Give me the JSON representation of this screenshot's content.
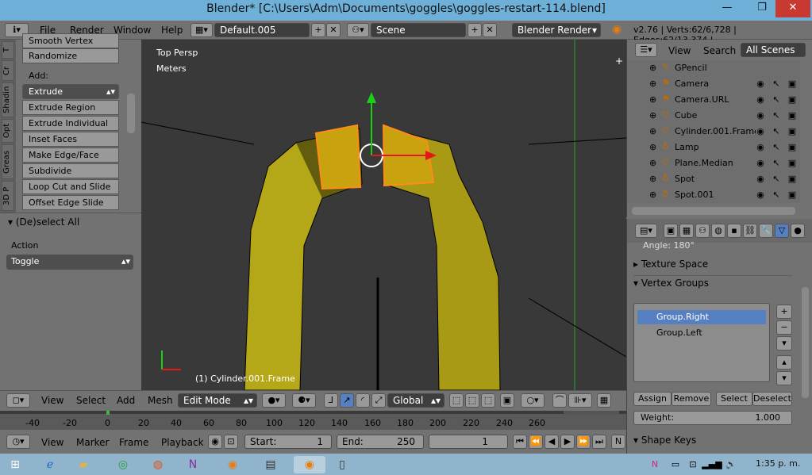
{
  "window": {
    "title": "Blender* [C:\\Users\\Adm\\Documents\\goggles\\goggles-restart-114.blend]",
    "minimize": "—",
    "maximize": "❐",
    "close": "✕"
  },
  "header": {
    "menus": [
      "File",
      "Render",
      "Window",
      "Help"
    ],
    "screen_layout": "Default.005",
    "scene": "Scene",
    "render_engine": "Blender Render",
    "stats": "v2.76 | Verts:62/6,728 | Edges:62/13,374 |"
  },
  "tools": {
    "tabs": [
      "T",
      "Cr",
      "Shadin",
      "Opt",
      "Greas",
      "3D P"
    ],
    "top_cut": "Smooth Vertex",
    "randomize": "Randomize",
    "add_label": "Add:",
    "extrude": "Extrude",
    "buttons": [
      "Extrude Region",
      "Extrude Individual",
      "Inset Faces",
      "Make Edge/Face",
      "Subdivide",
      "Loop Cut and Slide",
      "Offset Edge Slide"
    ],
    "operator_panel": "(De)select All",
    "action_label": "Action",
    "action_value": "Toggle"
  },
  "viewport": {
    "view_name": "Top Persp",
    "units": "Meters",
    "object_info": "(1) Cylinder.001.Frame"
  },
  "view3d_header": {
    "menus": [
      "View",
      "Select",
      "Add",
      "Mesh"
    ],
    "mode": "Edit Mode",
    "orientation": "Global"
  },
  "timeline": {
    "ruler_labels": [
      "-40",
      "-20",
      "0",
      "20",
      "40",
      "60",
      "80",
      "100",
      "120",
      "140",
      "160",
      "180",
      "200",
      "220",
      "240",
      "260"
    ],
    "menus": [
      "View",
      "Marker",
      "Frame",
      "Playback"
    ],
    "start_label": "Start:",
    "start_value": "1",
    "end_label": "End:",
    "end_value": "250",
    "current_frame": "1",
    "cut_label": "N"
  },
  "outliner": {
    "menus": [
      "View",
      "Search"
    ],
    "scope": "All Scenes",
    "items": [
      {
        "name": "GPencil",
        "icon": "grease-pencil-icon"
      },
      {
        "name": "Camera",
        "icon": "camera-icon"
      },
      {
        "name": "Camera.URL",
        "icon": "camera-icon"
      },
      {
        "name": "Cube",
        "icon": "mesh-icon"
      },
      {
        "name": "Cylinder.001.Frame",
        "icon": "mesh-icon"
      },
      {
        "name": "Lamp",
        "icon": "lamp-icon"
      },
      {
        "name": "Plane.Median",
        "icon": "mesh-icon"
      },
      {
        "name": "Spot",
        "icon": "lamp-icon"
      },
      {
        "name": "Spot.001",
        "icon": "lamp-icon"
      }
    ]
  },
  "properties": {
    "angle": "Angle:  180°",
    "texture_space": "Texture Space",
    "vertex_groups": "Vertex Groups",
    "groups": [
      "Group.Right",
      "Group.Left"
    ],
    "assign": "Assign",
    "remove": "Remove",
    "select": "Select",
    "deselect": "Deselect",
    "weight_label": "Weight:",
    "weight_value": "1.000",
    "shape_keys": "Shape Keys"
  },
  "taskbar": {
    "clock": "1:35 p. m."
  },
  "colors": {
    "accent": "#5680c2",
    "selected": "#ff8c1a",
    "mesh": "#b5a818"
  }
}
